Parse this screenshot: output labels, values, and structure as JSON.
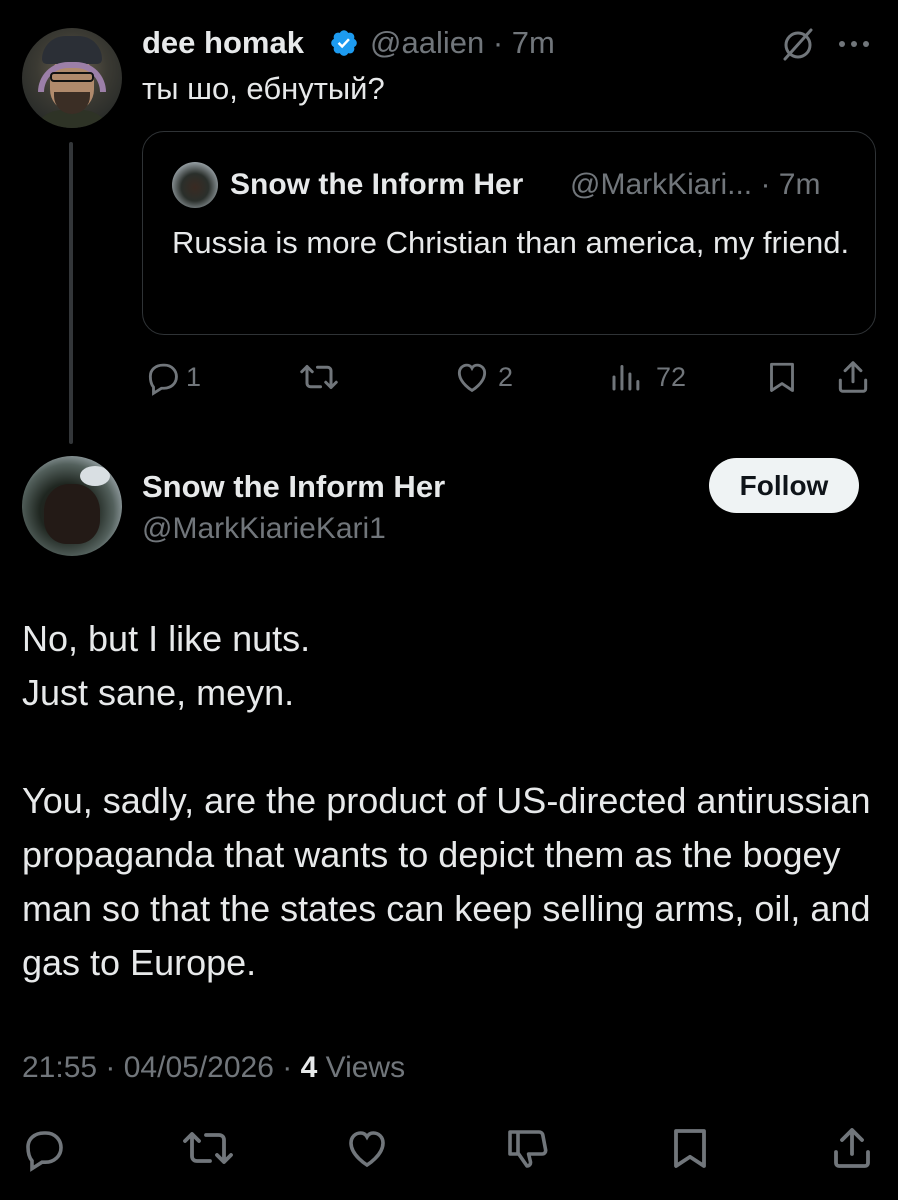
{
  "parent_tweet": {
    "display_name": "dee homak",
    "handle": "@aalien",
    "time": "· 7m",
    "text": "ты шо, ебнутый?",
    "quoted": {
      "display_name": "Snow the Inform Her",
      "handle": "@MarkKiari... · 7m",
      "text": "Russia is more Christian than america, my friend."
    },
    "actions": {
      "replies": "1",
      "reposts": "",
      "likes": "2",
      "views": "72"
    }
  },
  "main_tweet": {
    "display_name": "Snow the Inform Her",
    "handle": "@MarkKiarieKari1",
    "follow_label": "Follow",
    "body": {
      "line1": "No, but I like nuts.",
      "line2": "Just sane, meyn.",
      "para2": "You, sadly, are the product of US-directed antirussian propaganda that wants to depict them as the bogey man so that the states can keep selling arms, oil, and gas to Europe."
    },
    "meta": {
      "time": "21:55",
      "date": "04/05/2026",
      "views_count": "4",
      "views_label": "Views"
    }
  },
  "icons": {
    "verified": "verified-badge-icon",
    "grok": "slash-circle-icon",
    "more": "more-icon",
    "reply": "reply-icon",
    "repost": "repost-icon",
    "like": "like-icon",
    "views": "views-icon",
    "bookmark": "bookmark-icon",
    "share": "share-icon",
    "dislike": "dislike-icon"
  },
  "colors": {
    "background": "#000000",
    "text": "#e7e9ea",
    "muted": "#71767b",
    "verified": "#1d9bf0",
    "border": "#2f3336",
    "button_bg": "#eff3f4"
  }
}
